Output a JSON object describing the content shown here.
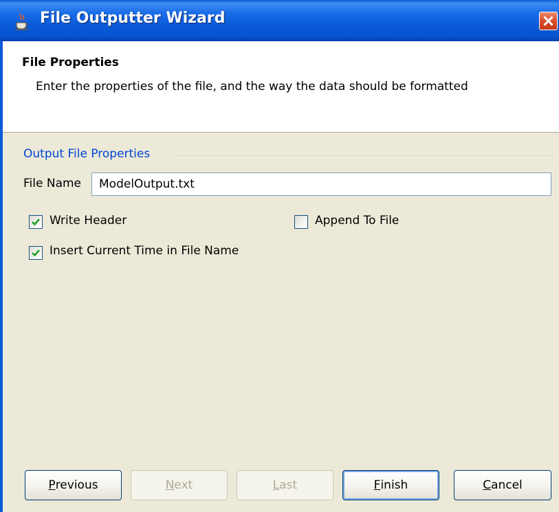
{
  "window": {
    "title": "File Outputter Wizard",
    "app_icon": "java-cup-icon"
  },
  "header": {
    "title": "File Properties",
    "description": "Enter the properties of the file, and the way the data should be formatted"
  },
  "group": {
    "label": "Output File Properties",
    "file_name_label": "File Name",
    "file_name_value": "ModelOutput.txt"
  },
  "options": {
    "write_header": {
      "label": "Write Header",
      "checked": true
    },
    "append_to_file": {
      "label": "Append To File",
      "checked": false
    },
    "insert_time": {
      "label": "Insert Current Time in File Name",
      "checked": true
    }
  },
  "buttons": {
    "previous": {
      "label": "Previous",
      "mnemonic": "P",
      "rest": "revious",
      "enabled": true
    },
    "next": {
      "label": "Next",
      "mnemonic": "N",
      "rest": "ext",
      "enabled": false
    },
    "last": {
      "label": "Last",
      "mnemonic": "L",
      "rest": "ast",
      "enabled": false
    },
    "finish": {
      "label": "Finish",
      "mnemonic": "F",
      "rest": "inish",
      "enabled": true
    },
    "cancel": {
      "label": "Cancel",
      "mnemonic": "C",
      "rest": "ancel",
      "enabled": true
    }
  },
  "colors": {
    "titlebar": "#0b5bd8",
    "group_label": "#0046d5",
    "background": "#ece9d8"
  }
}
